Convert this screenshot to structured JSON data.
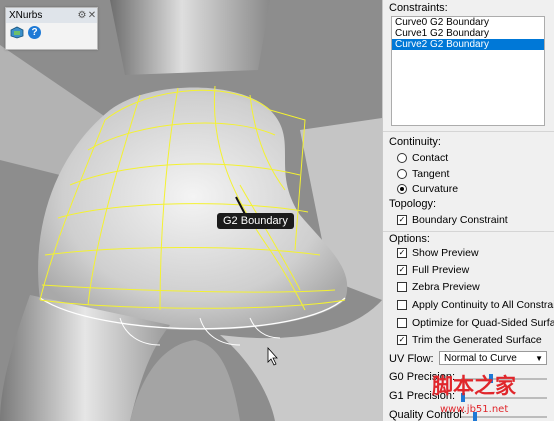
{
  "xnurbs": {
    "title": "XNurbs",
    "gear_icon": "gear-icon",
    "close_icon": "close-icon",
    "help_icon": "?"
  },
  "viewport": {
    "annotation": "G2 Boundary"
  },
  "panel": {
    "constraints_label": "Constraints:",
    "constraints": [
      {
        "text": "Curve0  G2  Boundary",
        "selected": false
      },
      {
        "text": "Curve1  G2  Boundary",
        "selected": false
      },
      {
        "text": "Curve2  G2  Boundary",
        "selected": true
      }
    ],
    "continuity_label": "Continuity:",
    "continuity": [
      "Contact",
      "Tangent",
      "Curvature"
    ],
    "continuity_selected": "Curvature",
    "topology_label": "Topology:",
    "boundary_constraint": "Boundary Constraint",
    "options_label": "Options:",
    "options": [
      {
        "label": "Show Preview",
        "checked": true
      },
      {
        "label": "Full Preview",
        "checked": true
      },
      {
        "label": "Zebra Preview",
        "checked": false
      },
      {
        "label": "Apply Continuity to All Constraints",
        "checked": false
      },
      {
        "label": "Optimize for Quad-Sided Surface",
        "checked": false
      },
      {
        "label": "Trim the Generated Surface",
        "checked": true
      }
    ],
    "uv_flow_label": "UV Flow:",
    "uv_flow_value": "Normal to Curve",
    "g0_precision": "G0 Precision:",
    "g1_precision": "G1 Precision:",
    "quality_control": "Quality Control:"
  },
  "watermark": {
    "text": "脚本之家",
    "url": "www.jb51.net"
  },
  "colors": {
    "accent": "#0078d7",
    "curve": "#f4f230",
    "viewport_bg": "#8d8d8d"
  }
}
